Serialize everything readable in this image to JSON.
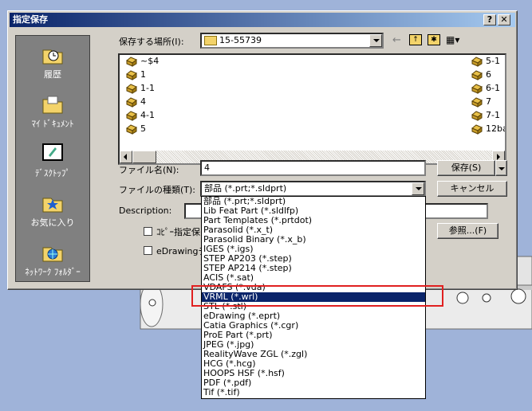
{
  "dialog": {
    "title": "指定保存",
    "help_btn": "?",
    "close_btn": "✕"
  },
  "places": [
    {
      "label": "履歴",
      "icon": "history-icon"
    },
    {
      "label": "ﾏｲ ﾄﾞｷｭﾒﾝﾄ",
      "icon": "my-documents-icon"
    },
    {
      "label": "ﾃﾞｽｸﾄｯﾌﾟ",
      "icon": "desktop-icon"
    },
    {
      "label": "お気に入り",
      "icon": "favorites-icon"
    },
    {
      "label": "ﾈｯﾄﾜｰｸ ﾌｫﾙﾀﾞｰ",
      "icon": "network-folder-icon"
    }
  ],
  "location": {
    "label": "保存する場所(I):",
    "value": "15-55739"
  },
  "files_left": [
    "~$4",
    "1",
    "1-1",
    "4",
    "4-1",
    "5"
  ],
  "files_right": [
    "5-1",
    "6",
    "6-1",
    "7",
    "7-1",
    "12ba"
  ],
  "filename": {
    "label": "ファイル名(N):",
    "value": "4"
  },
  "filetype": {
    "label": "ファイルの種類(T):",
    "value": "部品 (*.prt;*.sldprt)"
  },
  "description": {
    "label": "Description:"
  },
  "buttons": {
    "save": "保存(S)",
    "cancel": "キャンセル",
    "browse": "参照...(F)"
  },
  "checkboxes": [
    {
      "label": "ｺﾋﾟｰ指定保",
      "checked": false
    },
    {
      "label": "eDrawingデ",
      "checked": false
    }
  ],
  "filetype_options": [
    "部品 (*.prt;*.sldprt)",
    "Lib Feat Part (*.sldlfp)",
    "Part Templates (*.prtdot)",
    "Parasolid (*.x_t)",
    "Parasolid Binary (*.x_b)",
    "IGES (*.igs)",
    "STEP AP203 (*.step)",
    "STEP AP214 (*.step)",
    "ACIS (*.sat)",
    "VDAFS (*.vda)",
    "VRML (*.wrl)",
    "STL (*.stl)",
    "eDrawing (*.eprt)",
    "Catia Graphics (*.cgr)",
    "ProE Part (*.prt)",
    "JPEG (*.jpg)",
    "RealityWave ZGL (*.zgl)",
    "HCG (*.hcg)",
    "HOOPS HSF (*.hsf)",
    "PDF (*.pdf)",
    "Tif (*.tif)"
  ],
  "selected_option": "VRML (*.wrl)",
  "colors": {
    "dialog_bg": "#d4d0c8",
    "titlebar": "#0a246a",
    "highlight_box": "#e02020",
    "desktop_bg": "#9fb3d9"
  }
}
